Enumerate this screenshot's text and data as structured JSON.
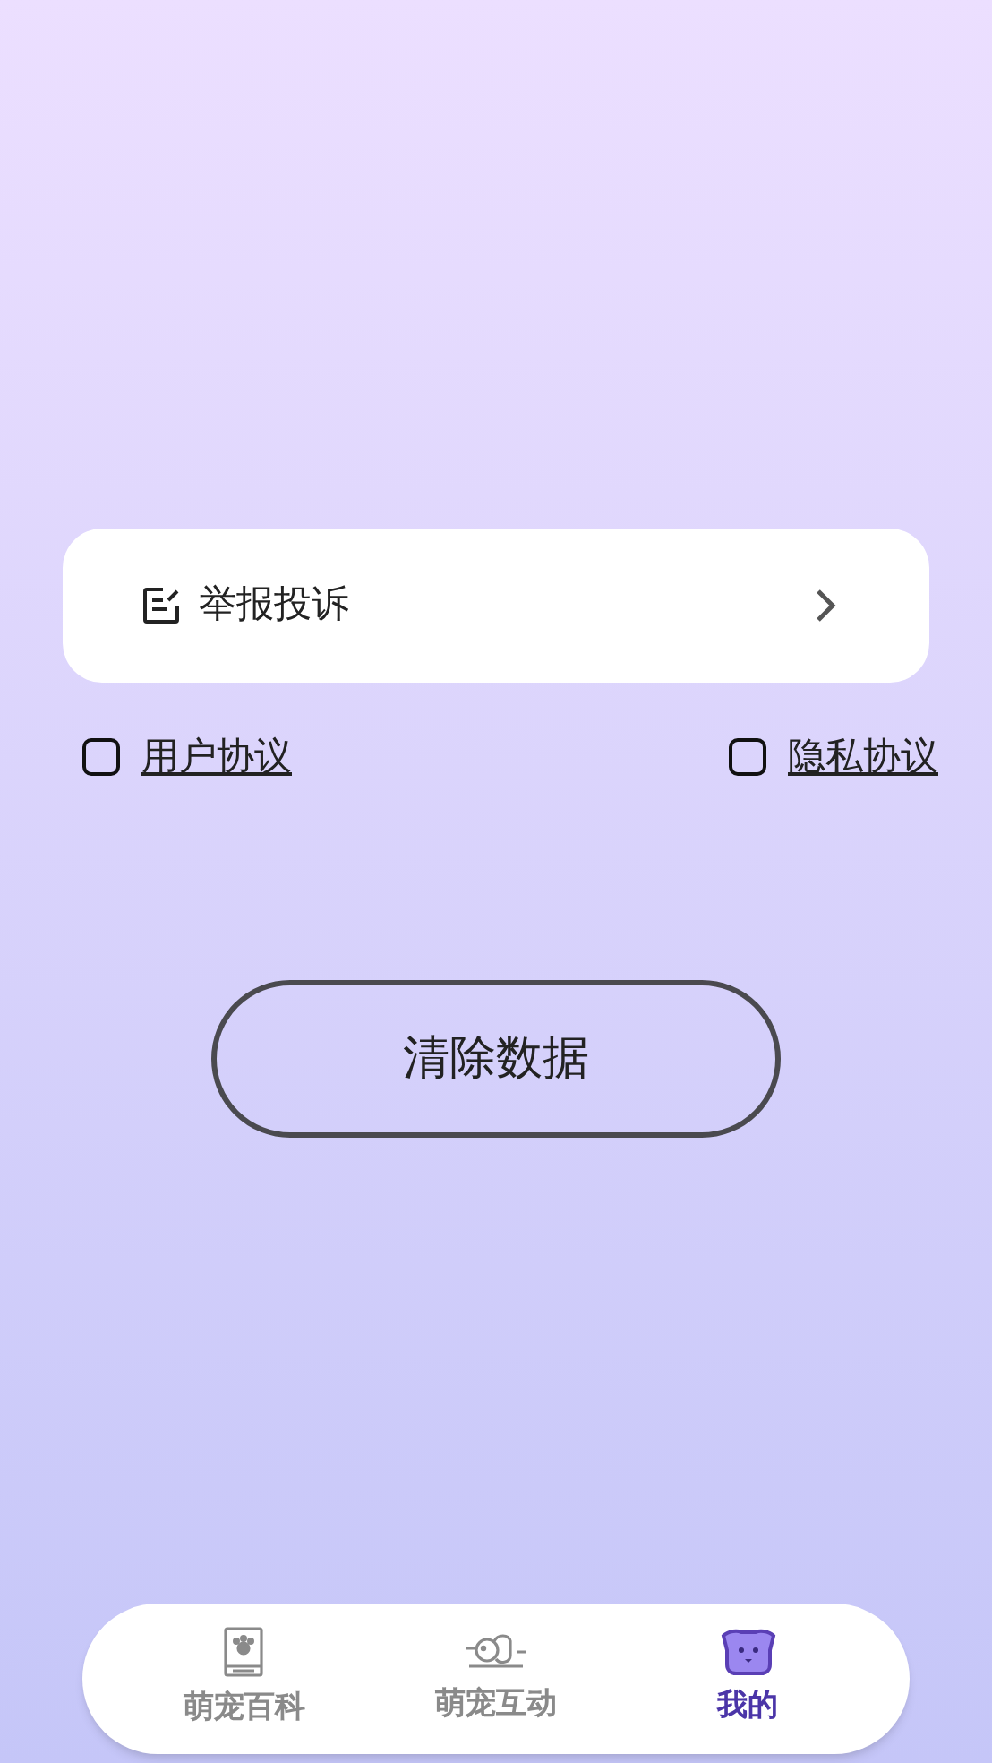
{
  "menu": [
    {
      "label": "举报投诉"
    }
  ],
  "agreements": [
    {
      "label": "用户协议",
      "checked": false
    },
    {
      "label": "隐私协议",
      "checked": false
    }
  ],
  "clear_button": "清除数据",
  "tabs": [
    {
      "label": "萌宠百科",
      "kind": "book",
      "selected": false
    },
    {
      "label": "萌宠互动",
      "kind": "pets",
      "selected": false
    },
    {
      "label": "我的",
      "kind": "dog",
      "selected": true
    }
  ]
}
